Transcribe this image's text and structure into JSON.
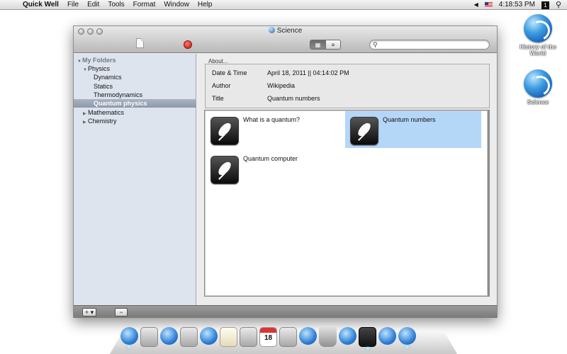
{
  "menubar": {
    "apple": "",
    "app_name": "Quick Well",
    "menus": [
      "File",
      "Edit",
      "Tools",
      "Format",
      "Window",
      "Help"
    ],
    "clock": "4:18:53 PM",
    "volume_icon": "◀",
    "user_badge": "1",
    "spotlight_icon": "⚲"
  },
  "desktop": {
    "icons": [
      {
        "label": "History of the World"
      },
      {
        "label": "Science"
      }
    ]
  },
  "window": {
    "title": "Science",
    "view_grid_glyph": "▦",
    "view_list_glyph": "≡",
    "search": {
      "value": "",
      "placeholder": ""
    }
  },
  "sidebar": {
    "header": "My Folders",
    "items": [
      {
        "label": "Physics",
        "level": 1,
        "expanded": true
      },
      {
        "label": "Dynamics",
        "level": 2
      },
      {
        "label": "Statics",
        "level": 2
      },
      {
        "label": "Thermodynamics",
        "level": 2
      },
      {
        "label": "Quantum physics",
        "level": 2,
        "selected": true
      },
      {
        "label": "Mathematics",
        "level": 1,
        "expanded": false
      },
      {
        "label": "Chemistry",
        "level": 1,
        "expanded": false
      }
    ]
  },
  "about": {
    "label": "About...",
    "rows": [
      {
        "key": "Date & Time",
        "value": "April 18, 2011 || 04:14:02 PM"
      },
      {
        "key": "Author",
        "value": "Wikipedia"
      },
      {
        "key": "Title",
        "value": "Quantum numbers"
      }
    ]
  },
  "documents": [
    {
      "title": "What is a quantum?",
      "selected": false
    },
    {
      "title": "Quantum numbers",
      "selected": true
    },
    {
      "title": "Quantum computer",
      "selected": false
    }
  ],
  "bottombar": {
    "add_label": "+ ▾",
    "remove_label": "−"
  },
  "dock": {
    "calendar_day": "18",
    "items": [
      "finder-icon",
      "system-preferences-icon",
      "app-store-icon",
      "mail-icon",
      "safari-icon",
      "notes-icon",
      "calculator-icon",
      "calendar-icon",
      "photos-icon",
      "itunes-icon",
      "trash-bin-icon",
      "xcode-icon",
      "terminal-icon",
      "quicktime-icon",
      "quick-well-icon"
    ]
  },
  "colors": {
    "selection": "#b4d6f7",
    "sidebar_bg": "#dde4ee",
    "sidebar_selection": "#97a2b3"
  }
}
